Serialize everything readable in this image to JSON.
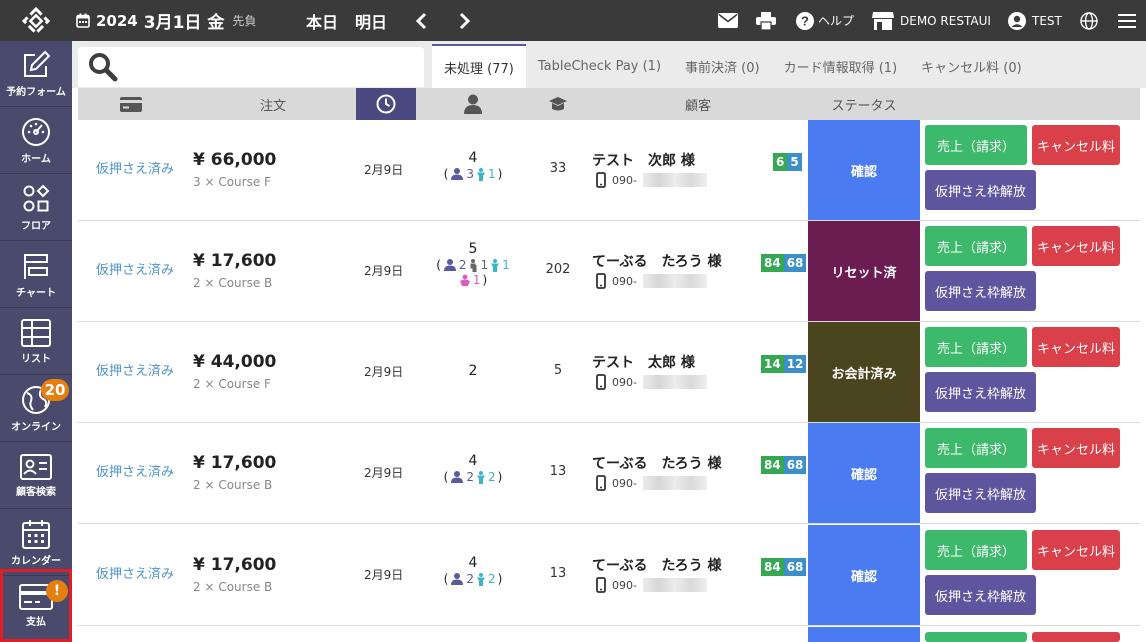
{
  "topbar": {
    "year": "2024",
    "month_day": "3月1日",
    "weekday": "金",
    "rokuyo": "先負",
    "today": "本日",
    "tomorrow": "明日",
    "help": "ヘルプ",
    "restaurant": "DEMO RESTAUI",
    "user": "TEST"
  },
  "sidebar": {
    "items": [
      {
        "label": "予約フォーム",
        "icon": "edit-icon"
      },
      {
        "label": "ホーム",
        "icon": "dashboard-icon"
      },
      {
        "label": "フロア",
        "icon": "floor-shapes-icon"
      },
      {
        "label": "チャート",
        "icon": "chart-icon"
      },
      {
        "label": "リスト",
        "icon": "list-icon"
      },
      {
        "label": "オンライン",
        "icon": "online-globe-icon",
        "badge": "20"
      },
      {
        "label": "顧客検索",
        "icon": "customer-card-icon"
      },
      {
        "label": "カレンダー",
        "icon": "calendar-icon"
      },
      {
        "label": "支払",
        "icon": "payment-card-icon",
        "badge": "!"
      }
    ]
  },
  "search": {
    "placeholder": ""
  },
  "tabs": [
    {
      "label": "未処理 (77)"
    },
    {
      "label": "TableCheck Pay (1)"
    },
    {
      "label": "事前決済 (0)"
    },
    {
      "label": "カード情報取得 (1)"
    },
    {
      "label": "キャンセル料 (0)"
    }
  ],
  "columns": {
    "order": "注文",
    "customer": "顧客",
    "status": "ステータス"
  },
  "colors": {
    "confirm": "#4a7bf0",
    "reset": "#6b1c50",
    "paid": "#4a451e",
    "green_btn": "#3cb96b",
    "red_btn": "#d9404a",
    "purple_btn": "#5f559e",
    "accent": "#4b4a80"
  },
  "buttons": {
    "sales": "売上（請求）",
    "cancel_fee": "キャンセル料",
    "release": "仮押さえ枠解放"
  },
  "rows": [
    {
      "status": "仮押さえ済み",
      "price": "¥ 66,000",
      "course": "3 × Course F",
      "date": "2月9日",
      "party": "4",
      "adults": "3",
      "kids": "1",
      "table": "33",
      "name": "テスト　次郎 様",
      "phone": "090-",
      "badge1": "6",
      "badge2": "5",
      "state": "確認"
    },
    {
      "status": "仮押さえ済み",
      "price": "¥ 17,600",
      "course": "2 × Course B",
      "date": "2月9日",
      "party": "5",
      "adults": "2",
      "seniors": "1",
      "kids": "1",
      "babies": "1",
      "table": "202",
      "name": "てーぶる　たろう 様",
      "phone": "090-",
      "badge1": "84",
      "badge2": "68",
      "state": "リセット済"
    },
    {
      "status": "仮押さえ済み",
      "price": "¥ 44,000",
      "course": "2 × Course F",
      "date": "2月9日",
      "party": "2",
      "table": "5",
      "name": "テスト　太郎 様",
      "phone": "090-",
      "badge1": "14",
      "badge2": "12",
      "state": "お会計済み"
    },
    {
      "status": "仮押さえ済み",
      "price": "¥ 17,600",
      "course": "2 × Course B",
      "date": "2月9日",
      "party": "4",
      "adults": "2",
      "kids": "2",
      "table": "13",
      "name": "てーぶる　たろう 様",
      "phone": "090-",
      "badge1": "84",
      "badge2": "68",
      "state": "確認"
    },
    {
      "status": "仮押さえ済み",
      "price": "¥ 17,600",
      "course": "2 × Course B",
      "date": "2月9日",
      "party": "4",
      "adults": "2",
      "kids": "2",
      "table": "13",
      "name": "てーぶる　たろう 様",
      "phone": "090-",
      "badge1": "84",
      "badge2": "68",
      "state": "確認"
    }
  ]
}
